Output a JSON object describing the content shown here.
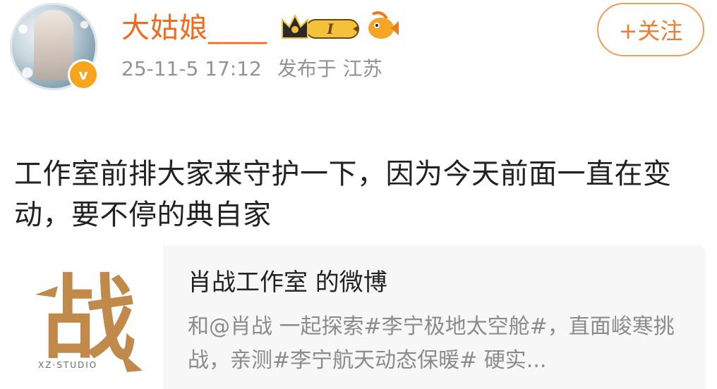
{
  "user": {
    "name": "大姑娘____",
    "vip_level": "I",
    "verified_mark": "v"
  },
  "meta": {
    "time": "25-11-5 17:12",
    "location": "发布于 江苏"
  },
  "follow_button": "+关注",
  "post": {
    "text": "工作室前排大家来守护一下，因为今天前面一直在变动，要不停的典自家"
  },
  "shared_card": {
    "logo_glyph": "战",
    "logo_caption": "XZ·STUDIO",
    "title": "肖战工作室 的微博",
    "description": "和@肖战 一起探索#李宁极地太空舱#，直面峻寒挑战，亲测#李宁航天动态保暖# 硬实..."
  },
  "colors": {
    "username": "#f26a1b",
    "follow_border": "#f29c56",
    "meta_text": "#939393",
    "logo": "#c28a4a"
  }
}
